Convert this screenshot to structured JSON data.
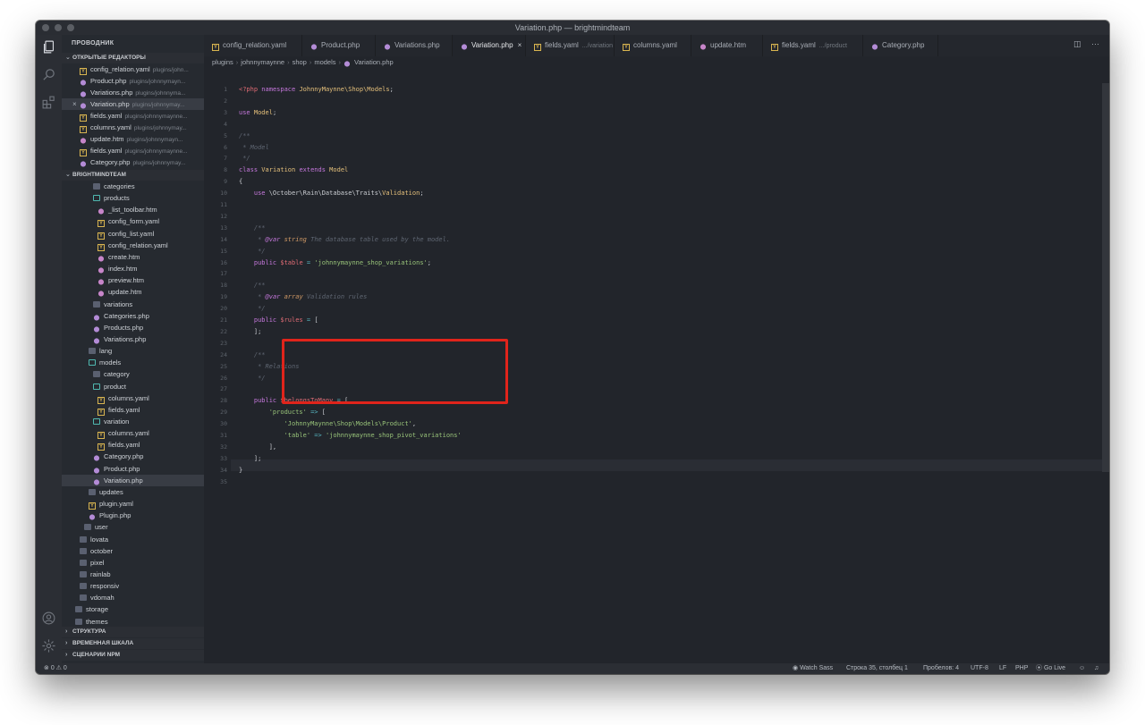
{
  "window": {
    "title": "Variation.php — brightmindteam"
  },
  "sidebar": {
    "explorer_title": "ПРОВОДНИК",
    "open_editors_title": "ОТКРЫТЫЕ РЕДАКТОРЫ",
    "open_editors": [
      {
        "name": "config_relation.yaml",
        "path": "plugins/john...",
        "icon": "yaml"
      },
      {
        "name": "Product.php",
        "path": "plugins/johnnymayn...",
        "icon": "php"
      },
      {
        "name": "Variations.php",
        "path": "plugins/johnnyma...",
        "icon": "php"
      },
      {
        "name": "Variation.php",
        "path": "plugins/johnnymay...",
        "icon": "php",
        "active": true
      },
      {
        "name": "fields.yaml",
        "path": "plugins/johnnymaynne...",
        "icon": "yaml"
      },
      {
        "name": "columns.yaml",
        "path": "plugins/johnnymay...",
        "icon": "yaml"
      },
      {
        "name": "update.htm",
        "path": "plugins/johnnymayn...",
        "icon": "htm"
      },
      {
        "name": "fields.yaml",
        "path": "plugins/johnnymaynne...",
        "icon": "yaml"
      },
      {
        "name": "Category.php",
        "path": "plugins/johnnymay...",
        "icon": "php"
      }
    ],
    "workspace_title": "BRIGHTMINDTEAM",
    "tree": [
      {
        "name": "categories",
        "icon": "folder",
        "indent": 3
      },
      {
        "name": "products",
        "icon": "folder-open",
        "indent": 3
      },
      {
        "name": "_list_toolbar.htm",
        "icon": "htm",
        "indent": 4
      },
      {
        "name": "config_form.yaml",
        "icon": "yaml",
        "indent": 4
      },
      {
        "name": "config_list.yaml",
        "icon": "yaml",
        "indent": 4
      },
      {
        "name": "config_relation.yaml",
        "icon": "yaml",
        "indent": 4
      },
      {
        "name": "create.htm",
        "icon": "htm",
        "indent": 4
      },
      {
        "name": "index.htm",
        "icon": "htm",
        "indent": 4
      },
      {
        "name": "preview.htm",
        "icon": "htm",
        "indent": 4
      },
      {
        "name": "update.htm",
        "icon": "htm",
        "indent": 4
      },
      {
        "name": "variations",
        "icon": "folder",
        "indent": 3
      },
      {
        "name": "Categories.php",
        "icon": "php",
        "indent": 3
      },
      {
        "name": "Products.php",
        "icon": "php",
        "indent": 3
      },
      {
        "name": "Variations.php",
        "icon": "php",
        "indent": 3
      },
      {
        "name": "lang",
        "icon": "folder",
        "indent": 2
      },
      {
        "name": "models",
        "icon": "folder-open",
        "indent": 2
      },
      {
        "name": "category",
        "icon": "folder",
        "indent": 3
      },
      {
        "name": "product",
        "icon": "folder-open",
        "indent": 3
      },
      {
        "name": "columns.yaml",
        "icon": "yaml",
        "indent": 4
      },
      {
        "name": "fields.yaml",
        "icon": "yaml",
        "indent": 4
      },
      {
        "name": "variation",
        "icon": "folder-open",
        "indent": 3
      },
      {
        "name": "columns.yaml",
        "icon": "yaml",
        "indent": 4
      },
      {
        "name": "fields.yaml",
        "icon": "yaml",
        "indent": 4
      },
      {
        "name": "Category.php",
        "icon": "php",
        "indent": 3
      },
      {
        "name": "Product.php",
        "icon": "php",
        "indent": 3
      },
      {
        "name": "Variation.php",
        "icon": "php",
        "indent": 3,
        "active": true
      },
      {
        "name": "updates",
        "icon": "folder",
        "indent": 2
      },
      {
        "name": "plugin.yaml",
        "icon": "yaml",
        "indent": 2
      },
      {
        "name": "Plugin.php",
        "icon": "php",
        "indent": 2
      },
      {
        "name": "user",
        "icon": "folder",
        "indent": 1
      },
      {
        "name": "lovata",
        "icon": "folder",
        "indent": 0
      },
      {
        "name": "october",
        "icon": "folder",
        "indent": 0
      },
      {
        "name": "pixel",
        "icon": "folder",
        "indent": 0
      },
      {
        "name": "rainlab",
        "icon": "folder",
        "indent": 0
      },
      {
        "name": "responsiv",
        "icon": "folder",
        "indent": 0
      },
      {
        "name": "vdomah",
        "icon": "folder",
        "indent": 0
      },
      {
        "name": "storage",
        "icon": "folder",
        "indent": -1
      },
      {
        "name": "themes",
        "icon": "folder",
        "indent": -1
      }
    ],
    "bottom_sections": [
      "СТРУКТУРА",
      "ВРЕМЕННАЯ ШКАЛА",
      "СЦЕНАРИИ NPM"
    ]
  },
  "tabs": [
    {
      "label": "config_relation.yaml",
      "icon": "yaml",
      "path": ""
    },
    {
      "label": "Product.php",
      "icon": "php",
      "path": ""
    },
    {
      "label": "Variations.php",
      "icon": "php",
      "path": ""
    },
    {
      "label": "Variation.php",
      "icon": "php",
      "path": "",
      "active": true
    },
    {
      "label": "fields.yaml",
      "icon": "yaml",
      "path": ".../variation"
    },
    {
      "label": "columns.yaml",
      "icon": "yaml",
      "path": ""
    },
    {
      "label": "update.htm",
      "icon": "htm",
      "path": ""
    },
    {
      "label": "fields.yaml",
      "icon": "yaml",
      "path": ".../product"
    },
    {
      "label": "Category.php",
      "icon": "php",
      "path": ""
    }
  ],
  "breadcrumb": [
    "plugins",
    "johnnymaynne",
    "shop",
    "models",
    "Variation.php"
  ],
  "code_lines": [
    [
      [
        "tag",
        "<?php "
      ],
      [
        "kw",
        "namespace "
      ],
      [
        "cls",
        "JohnnyMaynne\\Shop\\Models"
      ],
      [
        "",
        "; "
      ]
    ],
    [],
    [
      [
        "kw",
        "use "
      ],
      [
        "cls",
        "Model"
      ],
      [
        "",
        ";"
      ]
    ],
    [],
    [
      [
        "cmt",
        "/**"
      ]
    ],
    [
      [
        "cmt",
        " * Model"
      ]
    ],
    [
      [
        "cmt",
        " */"
      ]
    ],
    [
      [
        "kw",
        "class "
      ],
      [
        "cls",
        "Variation "
      ],
      [
        "kw",
        "extends "
      ],
      [
        "cls",
        "Model"
      ]
    ],
    [
      [
        "",
        "{"
      ]
    ],
    [
      [
        "",
        "    "
      ],
      [
        "kw",
        "use "
      ],
      [
        "",
        "\\October\\Rain\\Database\\Traits\\"
      ],
      [
        "cls",
        "Validation"
      ],
      [
        "",
        ";"
      ]
    ],
    [],
    [],
    [
      [
        "cmt",
        "    /**"
      ]
    ],
    [
      [
        "cmt",
        "     * "
      ],
      [
        "ann",
        "@var "
      ],
      [
        "typ",
        "string "
      ],
      [
        "cmt",
        "The database table used by the model."
      ]
    ],
    [
      [
        "cmt",
        "     */"
      ]
    ],
    [
      [
        "",
        "    "
      ],
      [
        "kw",
        "public "
      ],
      [
        "var",
        "$table "
      ],
      [
        "op",
        "= "
      ],
      [
        "str",
        "'johnnymaynne_shop_variations'"
      ],
      [
        "",
        ";"
      ]
    ],
    [],
    [
      [
        "cmt",
        "    /**"
      ]
    ],
    [
      [
        "cmt",
        "     * "
      ],
      [
        "ann",
        "@var "
      ],
      [
        "typ",
        "array "
      ],
      [
        "cmt",
        "Validation rules"
      ]
    ],
    [
      [
        "cmt",
        "     */"
      ]
    ],
    [
      [
        "",
        "    "
      ],
      [
        "kw",
        "public "
      ],
      [
        "var",
        "$rules "
      ],
      [
        "op",
        "= "
      ],
      [
        "",
        "["
      ]
    ],
    [
      [
        "",
        "    ];"
      ]
    ],
    [],
    [
      [
        "cmt",
        "    /**"
      ]
    ],
    [
      [
        "cmt",
        "     * Relations"
      ]
    ],
    [
      [
        "cmt",
        "     */"
      ]
    ],
    [],
    [
      [
        "",
        "    "
      ],
      [
        "kw",
        "public "
      ],
      [
        "var",
        "$belongsToMany "
      ],
      [
        "op",
        "= "
      ],
      [
        "",
        "["
      ]
    ],
    [
      [
        "",
        "        "
      ],
      [
        "str",
        "'products' "
      ],
      [
        "op",
        "=> "
      ],
      [
        "",
        "["
      ]
    ],
    [
      [
        "",
        "            "
      ],
      [
        "str",
        "'JohnnyMaynne\\Shop\\Models\\Product'"
      ],
      [
        "",
        ","
      ]
    ],
    [
      [
        "",
        "            "
      ],
      [
        "str",
        "'table' "
      ],
      [
        "op",
        "=> "
      ],
      [
        "str",
        "'johnnymaynne_shop_pivot_variations'"
      ]
    ],
    [
      [
        "",
        "        ],"
      ]
    ],
    [
      [
        "",
        "    ];"
      ]
    ],
    [
      [
        "",
        "}"
      ]
    ],
    []
  ],
  "statusbar": {
    "errors": "0",
    "warnings": "0",
    "watch_sass": "Watch Sass",
    "position": "Строка 35, столбец 1",
    "spaces": "Пробелов: 4",
    "encoding": "UTF-8",
    "eol": "LF",
    "language": "PHP",
    "go_live": "Go Live"
  },
  "colors": {
    "highlight_box": "#e0241b",
    "keyword": "#c678dd",
    "class": "#e5c07b",
    "string": "#98c379",
    "variable": "#e06c75"
  }
}
